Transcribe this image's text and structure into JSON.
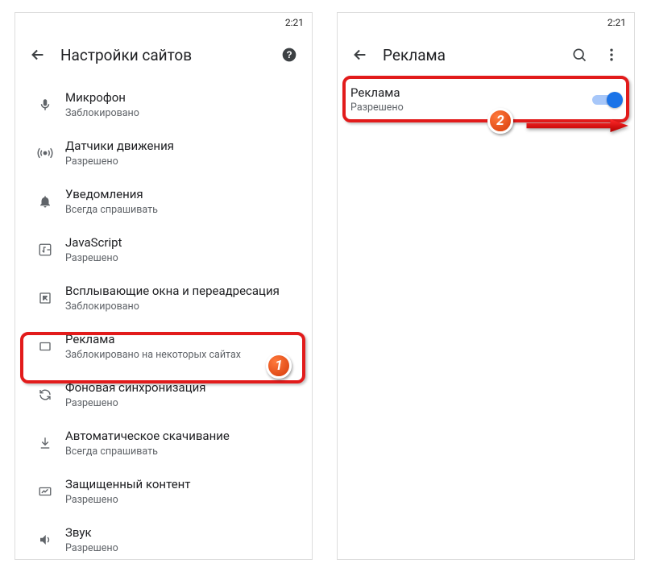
{
  "status": {
    "time": "2:21"
  },
  "left": {
    "title": "Настройки сайтов",
    "items": [
      {
        "label": "Микрофон",
        "sub": "Заблокировано",
        "icon": "mic-icon"
      },
      {
        "label": "Датчики движения",
        "sub": "Разрешено",
        "icon": "sensors-icon"
      },
      {
        "label": "Уведомления",
        "sub": "Всегда спрашивать",
        "icon": "bell-icon"
      },
      {
        "label": "JavaScript",
        "sub": "Разрешено",
        "icon": "js-icon"
      },
      {
        "label": "Всплывающие окна и переадресация",
        "sub": "Заблокировано",
        "icon": "popup-icon"
      },
      {
        "label": "Реклама",
        "sub": "Заблокировано на некоторых сайтах",
        "icon": "ads-icon"
      },
      {
        "label": "Фоновая синхронизация",
        "sub": "Разрешено",
        "icon": "sync-icon"
      },
      {
        "label": "Автоматическое скачивание",
        "sub": "Всегда спрашивать",
        "icon": "download-icon"
      },
      {
        "label": "Защищенный контент",
        "sub": "Разрешено",
        "icon": "protected-icon"
      },
      {
        "label": "Звук",
        "sub": "Разрешено",
        "icon": "sound-icon"
      }
    ]
  },
  "right": {
    "title": "Реклама",
    "toggle": {
      "label": "Реклама",
      "sub": "Разрешено",
      "on": true
    }
  },
  "annotations": {
    "badge1": "1",
    "badge2": "2"
  }
}
